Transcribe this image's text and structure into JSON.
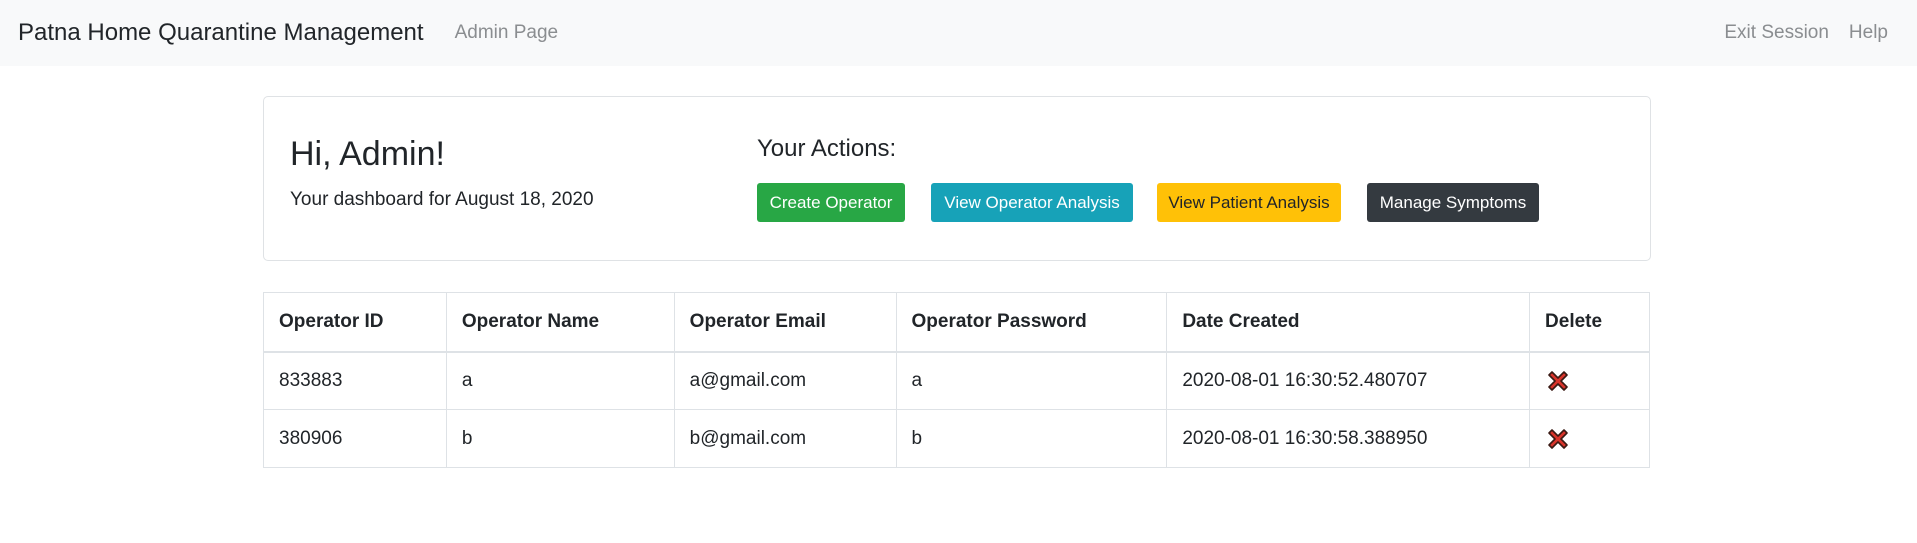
{
  "navbar": {
    "brand": "Patna Home Quarantine Management",
    "page_link": "Admin Page",
    "exit_link": "Exit Session",
    "help_link": "Help"
  },
  "dashboard": {
    "greeting": "Hi, Admin!",
    "subtitle": "Your dashboard for August 18, 2020",
    "actions_title": "Your Actions:",
    "buttons": {
      "create_operator": "Create Operator",
      "view_operator_analysis": "View Operator Analysis",
      "view_patient_analysis": "View Patient Analysis",
      "manage_symptoms": "Manage Symptoms"
    },
    "button_colors": {
      "create_operator": "#28a745",
      "view_operator_analysis": "#17a2b8",
      "view_patient_analysis": "#ffc107",
      "manage_symptoms": "#343a40"
    }
  },
  "table": {
    "headers": [
      "Operator ID",
      "Operator Name",
      "Operator Email",
      "Operator Password",
      "Date Created",
      "Delete"
    ],
    "rows": [
      {
        "id": "833883",
        "name": "a",
        "email": "a@gmail.com",
        "password": "a",
        "created": "2020-08-01 16:30:52.480707",
        "delete_icon": "red-x-icon"
      },
      {
        "id": "380906",
        "name": "b",
        "email": "b@gmail.com",
        "password": "b",
        "created": "2020-08-01 16:30:58.388950",
        "delete_icon": "red-x-icon"
      }
    ]
  }
}
